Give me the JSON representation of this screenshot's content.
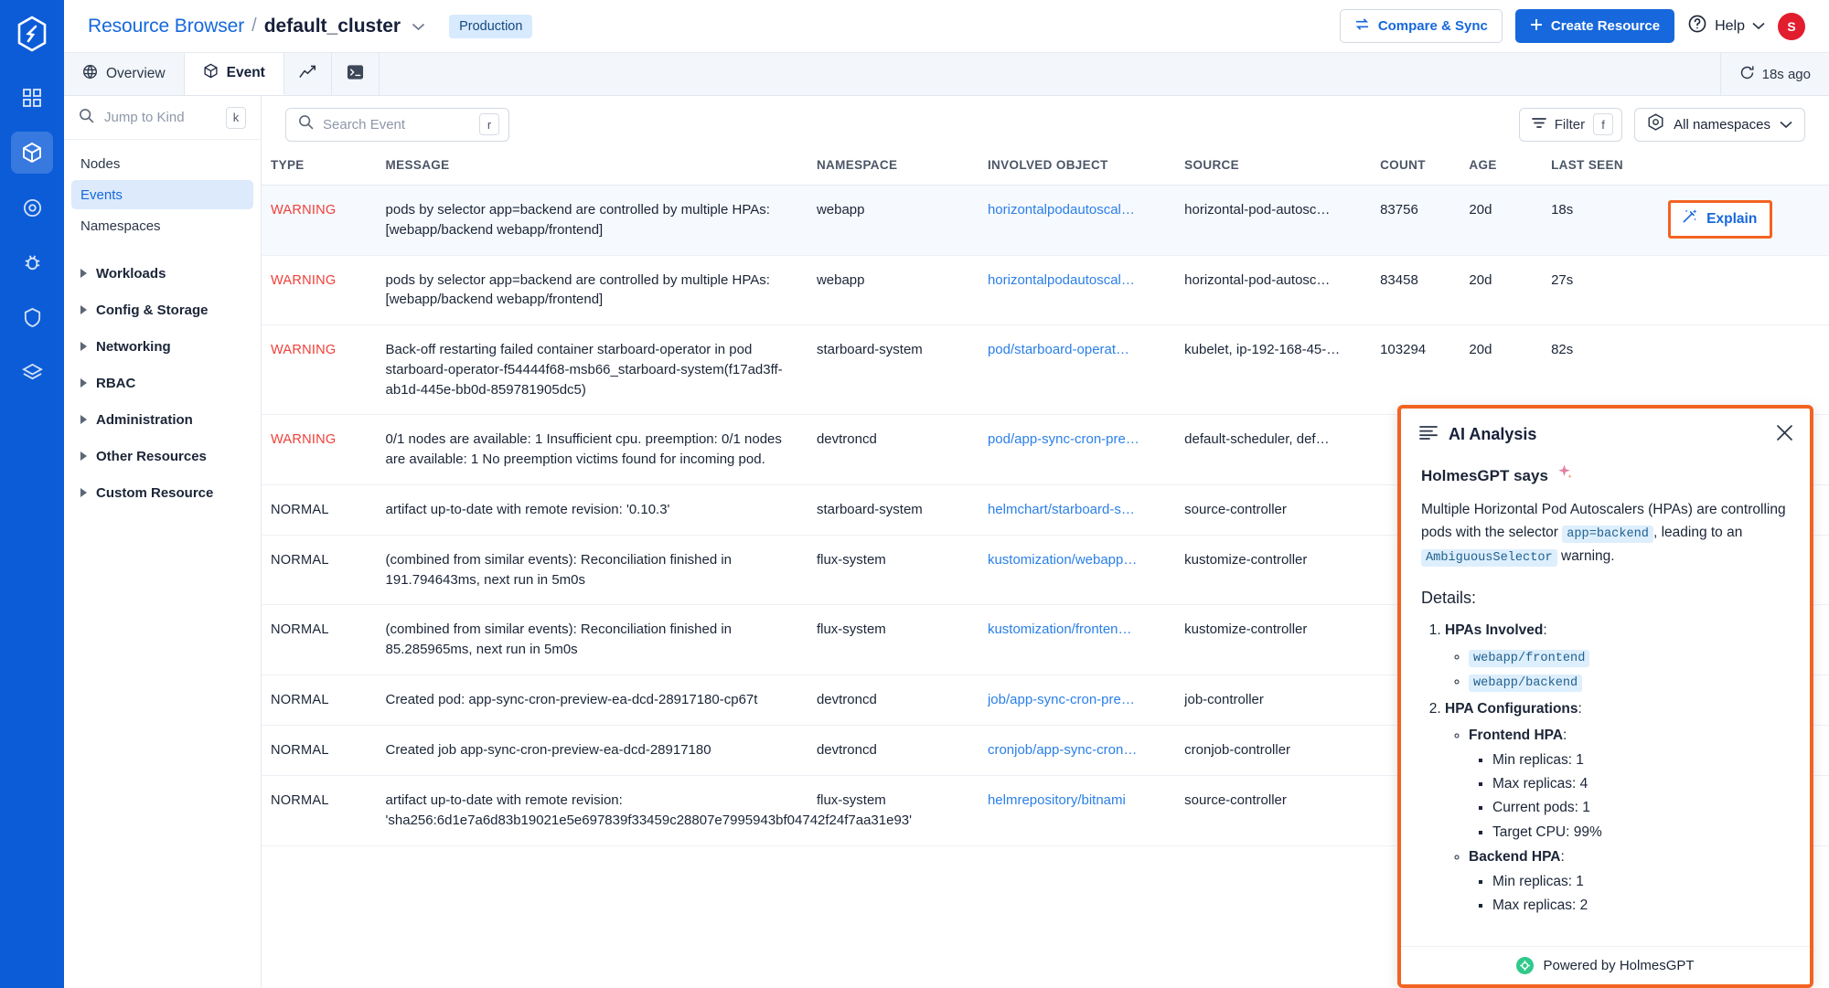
{
  "rail": {
    "logo": "devtron-logo",
    "items": [
      {
        "name": "apps-grid-icon",
        "active": false
      },
      {
        "name": "cube-icon",
        "active": true
      },
      {
        "name": "target-icon",
        "active": false
      },
      {
        "name": "bug-icon",
        "active": false
      },
      {
        "name": "shield-icon",
        "active": false
      },
      {
        "name": "layers-icon",
        "active": false
      }
    ]
  },
  "header": {
    "breadcrumb_root": "Resource Browser",
    "breadcrumb_sep": "/",
    "breadcrumb_current": "default_cluster",
    "env_badge": "Production",
    "compare_sync": "Compare & Sync",
    "create_resource": "Create Resource",
    "help": "Help",
    "avatar_initial": "S"
  },
  "tabs": [
    {
      "label": "Overview",
      "icon": "globe-icon",
      "active": false
    },
    {
      "label": "Event",
      "icon": "cube-icon",
      "active": true
    },
    {
      "label": "",
      "icon": "chart-icon",
      "active": false
    },
    {
      "label": "",
      "icon": "terminal-icon",
      "active": false
    }
  ],
  "refresh": {
    "label": "18s ago",
    "icon": "refresh-icon"
  },
  "sidebar": {
    "jump_placeholder": "Jump to Kind",
    "jump_kbd": "k",
    "items": [
      {
        "label": "Nodes",
        "active": false
      },
      {
        "label": "Events",
        "active": true
      },
      {
        "label": "Namespaces",
        "active": false
      }
    ],
    "groups": [
      {
        "label": "Workloads"
      },
      {
        "label": "Config & Storage"
      },
      {
        "label": "Networking"
      },
      {
        "label": "RBAC"
      },
      {
        "label": "Administration"
      },
      {
        "label": "Other Resources"
      },
      {
        "label": "Custom Resource"
      }
    ]
  },
  "toolbar": {
    "search_placeholder": "Search Event",
    "search_kbd": "r",
    "filter_label": "Filter",
    "filter_kbd": "f",
    "namespace_label": "All namespaces"
  },
  "table": {
    "columns": [
      "TYPE",
      "MESSAGE",
      "NAMESPACE",
      "INVOLVED OBJECT",
      "SOURCE",
      "COUNT",
      "AGE",
      "LAST SEEN"
    ],
    "rows": [
      {
        "type": "WARNING",
        "message": "pods by selector app=backend are controlled by multiple HPAs: [webapp/backend webapp/frontend]",
        "namespace": "webapp",
        "object": "horizontalpodautoscal…",
        "source": "horizontal-pod-autosc…",
        "count": "83756",
        "age": "20d",
        "last_seen": "18s",
        "selected": true,
        "explain": "Explain"
      },
      {
        "type": "WARNING",
        "message": "pods by selector app=backend are controlled by multiple HPAs: [webapp/backend webapp/frontend]",
        "namespace": "webapp",
        "object": "horizontalpodautoscal…",
        "source": "horizontal-pod-autosc…",
        "count": "83458",
        "age": "20d",
        "last_seen": "27s",
        "selected": false,
        "explain": ""
      },
      {
        "type": "WARNING",
        "message": "Back-off restarting failed container starboard-operator in pod starboard-operator-f54444f68-msb66_starboard-system(f17ad3ff-ab1d-445e-bb0d-859781905dc5)",
        "namespace": "starboard-system",
        "object": "pod/starboard-operat…",
        "source": "kubelet, ip-192-168-45-…",
        "count": "103294",
        "age": "20d",
        "last_seen": "82s",
        "selected": false,
        "explain": ""
      },
      {
        "type": "WARNING",
        "message": "0/1 nodes are available: 1 Insufficient cpu. preemption: 0/1 nodes are available: 1 No preemption victims found for incoming pod.",
        "namespace": "devtroncd",
        "object": "pod/app-sync-cron-pre…",
        "source": "default-scheduler, def…",
        "count": "",
        "age": "",
        "last_seen": "",
        "selected": false,
        "explain": ""
      },
      {
        "type": "NORMAL",
        "message": "artifact up-to-date with remote revision: '0.10.3'",
        "namespace": "starboard-system",
        "object": "helmchart/starboard-s…",
        "source": "source-controller",
        "count": "",
        "age": "",
        "last_seen": "",
        "selected": false,
        "explain": ""
      },
      {
        "type": "NORMAL",
        "message": "(combined from similar events): Reconciliation finished in 191.794643ms, next run in 5m0s",
        "namespace": "flux-system",
        "object": "kustomization/webapp…",
        "source": "kustomize-controller",
        "count": "",
        "age": "",
        "last_seen": "",
        "selected": false,
        "explain": ""
      },
      {
        "type": "NORMAL",
        "message": "(combined from similar events): Reconciliation finished in 85.285965ms, next run in 5m0s",
        "namespace": "flux-system",
        "object": "kustomization/fronten…",
        "source": "kustomize-controller",
        "count": "",
        "age": "",
        "last_seen": "",
        "selected": false,
        "explain": ""
      },
      {
        "type": "NORMAL",
        "message": "Created pod: app-sync-cron-preview-ea-dcd-28917180-cp67t",
        "namespace": "devtroncd",
        "object": "job/app-sync-cron-pre…",
        "source": "job-controller",
        "count": "",
        "age": "",
        "last_seen": "",
        "selected": false,
        "explain": ""
      },
      {
        "type": "NORMAL",
        "message": "Created job app-sync-cron-preview-ea-dcd-28917180",
        "namespace": "devtroncd",
        "object": "cronjob/app-sync-cron…",
        "source": "cronjob-controller",
        "count": "",
        "age": "",
        "last_seen": "",
        "selected": false,
        "explain": ""
      },
      {
        "type": "NORMAL",
        "message": "artifact up-to-date with remote revision: 'sha256:6d1e7a6d83b19021e5e697839f33459c28807e7995943bf04742f24f7aa31e93'",
        "namespace": "flux-system",
        "object": "helmrepository/bitnami",
        "source": "source-controller",
        "count": "",
        "age": "",
        "last_seen": "",
        "selected": false,
        "explain": ""
      }
    ]
  },
  "ai_panel": {
    "title": "AI Analysis",
    "says_label": "HolmesGPT says",
    "sparkle": "✨",
    "summary_pre": "Multiple Horizontal Pod Autoscalers (HPAs) are controlling pods with the selector ",
    "summary_code1": "app=backend",
    "summary_mid": ", leading to an ",
    "summary_code2": "AmbiguousSelector",
    "summary_post": " warning.",
    "details_heading": "Details:",
    "item1_label": "HPAs Involved",
    "hpas": [
      "webapp/frontend",
      "webapp/backend"
    ],
    "item2_label": "HPA Configurations",
    "configs": [
      {
        "name": "Frontend HPA",
        "props": [
          "Min replicas: 1",
          "Max replicas: 4",
          "Current pods: 1",
          "Target CPU: 99%"
        ]
      },
      {
        "name": "Backend HPA",
        "props": [
          "Min replicas: 1",
          "Max replicas: 2"
        ]
      }
    ],
    "footer": "Powered by HolmesGPT",
    "close_icon": "close-icon",
    "accent_color": "#f26322"
  }
}
